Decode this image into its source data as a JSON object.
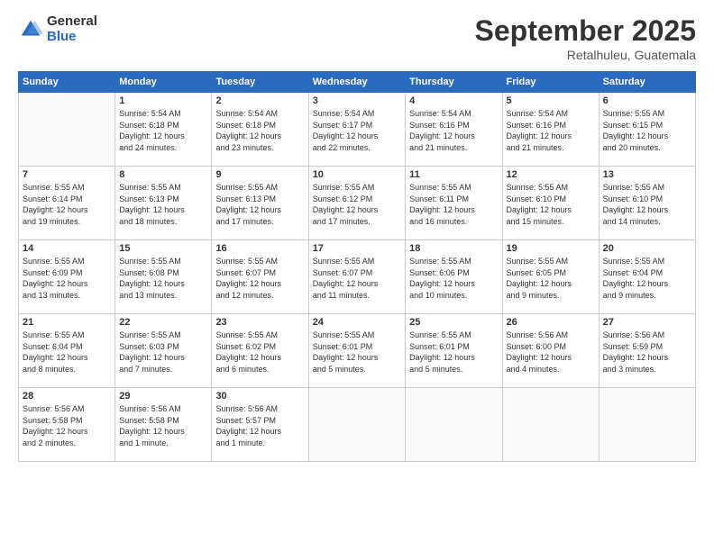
{
  "logo": {
    "general": "General",
    "blue": "Blue"
  },
  "header": {
    "month": "September 2025",
    "location": "Retalhuleu, Guatemala"
  },
  "weekdays": [
    "Sunday",
    "Monday",
    "Tuesday",
    "Wednesday",
    "Thursday",
    "Friday",
    "Saturday"
  ],
  "weeks": [
    [
      {
        "day": "",
        "info": ""
      },
      {
        "day": "1",
        "info": "Sunrise: 5:54 AM\nSunset: 6:18 PM\nDaylight: 12 hours\nand 24 minutes."
      },
      {
        "day": "2",
        "info": "Sunrise: 5:54 AM\nSunset: 6:18 PM\nDaylight: 12 hours\nand 23 minutes."
      },
      {
        "day": "3",
        "info": "Sunrise: 5:54 AM\nSunset: 6:17 PM\nDaylight: 12 hours\nand 22 minutes."
      },
      {
        "day": "4",
        "info": "Sunrise: 5:54 AM\nSunset: 6:16 PM\nDaylight: 12 hours\nand 21 minutes."
      },
      {
        "day": "5",
        "info": "Sunrise: 5:54 AM\nSunset: 6:16 PM\nDaylight: 12 hours\nand 21 minutes."
      },
      {
        "day": "6",
        "info": "Sunrise: 5:55 AM\nSunset: 6:15 PM\nDaylight: 12 hours\nand 20 minutes."
      }
    ],
    [
      {
        "day": "7",
        "info": "Sunrise: 5:55 AM\nSunset: 6:14 PM\nDaylight: 12 hours\nand 19 minutes."
      },
      {
        "day": "8",
        "info": "Sunrise: 5:55 AM\nSunset: 6:13 PM\nDaylight: 12 hours\nand 18 minutes."
      },
      {
        "day": "9",
        "info": "Sunrise: 5:55 AM\nSunset: 6:13 PM\nDaylight: 12 hours\nand 17 minutes."
      },
      {
        "day": "10",
        "info": "Sunrise: 5:55 AM\nSunset: 6:12 PM\nDaylight: 12 hours\nand 17 minutes."
      },
      {
        "day": "11",
        "info": "Sunrise: 5:55 AM\nSunset: 6:11 PM\nDaylight: 12 hours\nand 16 minutes."
      },
      {
        "day": "12",
        "info": "Sunrise: 5:55 AM\nSunset: 6:10 PM\nDaylight: 12 hours\nand 15 minutes."
      },
      {
        "day": "13",
        "info": "Sunrise: 5:55 AM\nSunset: 6:10 PM\nDaylight: 12 hours\nand 14 minutes."
      }
    ],
    [
      {
        "day": "14",
        "info": "Sunrise: 5:55 AM\nSunset: 6:09 PM\nDaylight: 12 hours\nand 13 minutes."
      },
      {
        "day": "15",
        "info": "Sunrise: 5:55 AM\nSunset: 6:08 PM\nDaylight: 12 hours\nand 13 minutes."
      },
      {
        "day": "16",
        "info": "Sunrise: 5:55 AM\nSunset: 6:07 PM\nDaylight: 12 hours\nand 12 minutes."
      },
      {
        "day": "17",
        "info": "Sunrise: 5:55 AM\nSunset: 6:07 PM\nDaylight: 12 hours\nand 11 minutes."
      },
      {
        "day": "18",
        "info": "Sunrise: 5:55 AM\nSunset: 6:06 PM\nDaylight: 12 hours\nand 10 minutes."
      },
      {
        "day": "19",
        "info": "Sunrise: 5:55 AM\nSunset: 6:05 PM\nDaylight: 12 hours\nand 9 minutes."
      },
      {
        "day": "20",
        "info": "Sunrise: 5:55 AM\nSunset: 6:04 PM\nDaylight: 12 hours\nand 9 minutes."
      }
    ],
    [
      {
        "day": "21",
        "info": "Sunrise: 5:55 AM\nSunset: 6:04 PM\nDaylight: 12 hours\nand 8 minutes."
      },
      {
        "day": "22",
        "info": "Sunrise: 5:55 AM\nSunset: 6:03 PM\nDaylight: 12 hours\nand 7 minutes."
      },
      {
        "day": "23",
        "info": "Sunrise: 5:55 AM\nSunset: 6:02 PM\nDaylight: 12 hours\nand 6 minutes."
      },
      {
        "day": "24",
        "info": "Sunrise: 5:55 AM\nSunset: 6:01 PM\nDaylight: 12 hours\nand 5 minutes."
      },
      {
        "day": "25",
        "info": "Sunrise: 5:55 AM\nSunset: 6:01 PM\nDaylight: 12 hours\nand 5 minutes."
      },
      {
        "day": "26",
        "info": "Sunrise: 5:56 AM\nSunset: 6:00 PM\nDaylight: 12 hours\nand 4 minutes."
      },
      {
        "day": "27",
        "info": "Sunrise: 5:56 AM\nSunset: 5:59 PM\nDaylight: 12 hours\nand 3 minutes."
      }
    ],
    [
      {
        "day": "28",
        "info": "Sunrise: 5:56 AM\nSunset: 5:58 PM\nDaylight: 12 hours\nand 2 minutes."
      },
      {
        "day": "29",
        "info": "Sunrise: 5:56 AM\nSunset: 5:58 PM\nDaylight: 12 hours\nand 1 minute."
      },
      {
        "day": "30",
        "info": "Sunrise: 5:56 AM\nSunset: 5:57 PM\nDaylight: 12 hours\nand 1 minute."
      },
      {
        "day": "",
        "info": ""
      },
      {
        "day": "",
        "info": ""
      },
      {
        "day": "",
        "info": ""
      },
      {
        "day": "",
        "info": ""
      }
    ]
  ]
}
